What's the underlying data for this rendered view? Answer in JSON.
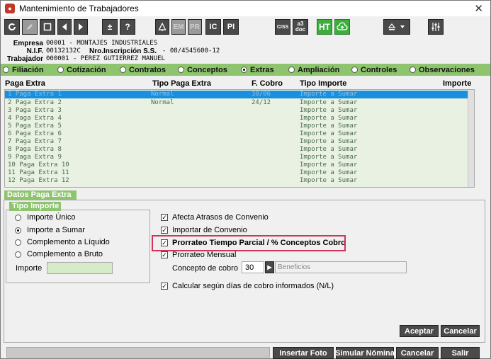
{
  "window": {
    "title": "Mantenimiento de Trabajadores",
    "close": "✕"
  },
  "toolbar": {
    "plus_minus": "±",
    "help": "?",
    "em": "EM",
    "pr": "PR",
    "ic": "IC",
    "pi": "PI",
    "ciss": "CISS",
    "a3doc_line1": "a3",
    "a3doc_line2": "doc",
    "ht": "HT"
  },
  "header": {
    "empresa_label": "Empresa",
    "empresa_value": "00001    - MONTAJES INDUSTRIALES",
    "nif_label": "N.I.F.",
    "nif_value": "00132132C",
    "nro_label": "Nro.Inscripción S.S.",
    "nro_value": "- 08/4545600-12",
    "trabajador_label": "Trabajador",
    "trabajador_value": "000001   - PEREZ GUTIERREZ MANUEL"
  },
  "tabs": [
    {
      "label": "Filiación",
      "selected": false
    },
    {
      "label": "Cotización",
      "selected": false
    },
    {
      "label": "Contratos",
      "selected": false
    },
    {
      "label": "Conceptos",
      "selected": false
    },
    {
      "label": "Extras",
      "selected": true
    },
    {
      "label": "Ampliación",
      "selected": false
    },
    {
      "label": "Controles",
      "selected": false
    },
    {
      "label": "Observaciones",
      "selected": false
    }
  ],
  "grid": {
    "headers": [
      "Paga Extra",
      "Tipo Paga Extra",
      "F. Cobro",
      "Tipo Importe",
      "Importe"
    ],
    "rows": [
      {
        "paga": "1 Paga Extra 1",
        "tipo": "Normal",
        "cobro": "30/06",
        "importe_tipo": "Importe a Sumar",
        "selected": true
      },
      {
        "paga": "2 Paga Extra 2",
        "tipo": "Normal",
        "cobro": "24/12",
        "importe_tipo": "Importe a Sumar"
      },
      {
        "paga": "3 Paga Extra 3",
        "tipo": "",
        "cobro": "",
        "importe_tipo": "Importe a Sumar"
      },
      {
        "paga": "4 Paga Extra 4",
        "tipo": "",
        "cobro": "",
        "importe_tipo": "Importe a Sumar"
      },
      {
        "paga": "5 Paga Extra 5",
        "tipo": "",
        "cobro": "",
        "importe_tipo": "Importe a Sumar"
      },
      {
        "paga": "6 Paga Extra 6",
        "tipo": "",
        "cobro": "",
        "importe_tipo": "Importe a Sumar"
      },
      {
        "paga": "7 Paga Extra 7",
        "tipo": "",
        "cobro": "",
        "importe_tipo": "Importe a Sumar"
      },
      {
        "paga": "8 Paga Extra 8",
        "tipo": "",
        "cobro": "",
        "importe_tipo": "Importe a Sumar"
      },
      {
        "paga": "9 Paga Extra 9",
        "tipo": "",
        "cobro": "",
        "importe_tipo": "Importe a Sumar"
      },
      {
        "paga": "10 Paga Extra 10",
        "tipo": "",
        "cobro": "",
        "importe_tipo": "Importe a Sumar"
      },
      {
        "paga": "11 Paga Extra 11",
        "tipo": "",
        "cobro": "",
        "importe_tipo": "Importe a Sumar"
      },
      {
        "paga": "12 Paga Extra 12",
        "tipo": "",
        "cobro": "",
        "importe_tipo": "Importe a Sumar"
      }
    ]
  },
  "datos": {
    "section_title": "Datos Paga Extra",
    "tipo_importe_title": "Tipo Importe",
    "options": [
      {
        "label": "Importe Único",
        "selected": false
      },
      {
        "label": "Importe a Sumar",
        "selected": true
      },
      {
        "label": "Complemento a Líquido",
        "selected": false
      },
      {
        "label": "Complemento a Bruto",
        "selected": false
      }
    ],
    "importe_label": "Importe",
    "importe_value": "",
    "checks": {
      "afecta": "Afecta Atrasos de Convenio",
      "importar": "Importar de Convenio",
      "prorrateo_tp": "Prorrateo Tiempo Parcial / % Conceptos Cobro",
      "prorrateo_mensual": "Prorrateo Mensual",
      "calcular": "Calcular según días de cobro informados (N/L)"
    },
    "check_mark": "✓",
    "concepto_label": "Concepto de cobro",
    "concepto_code": "30",
    "concepto_desc": "Beneficios",
    "concepto_arrow": "▶"
  },
  "buttons": {
    "aceptar": "Aceptar",
    "cancelar": "Cancelar",
    "insertar_foto": "Insertar Foto",
    "simular_nomina": "Simular Nómina",
    "cancelar2": "Cancelar",
    "salir": "Salir"
  }
}
